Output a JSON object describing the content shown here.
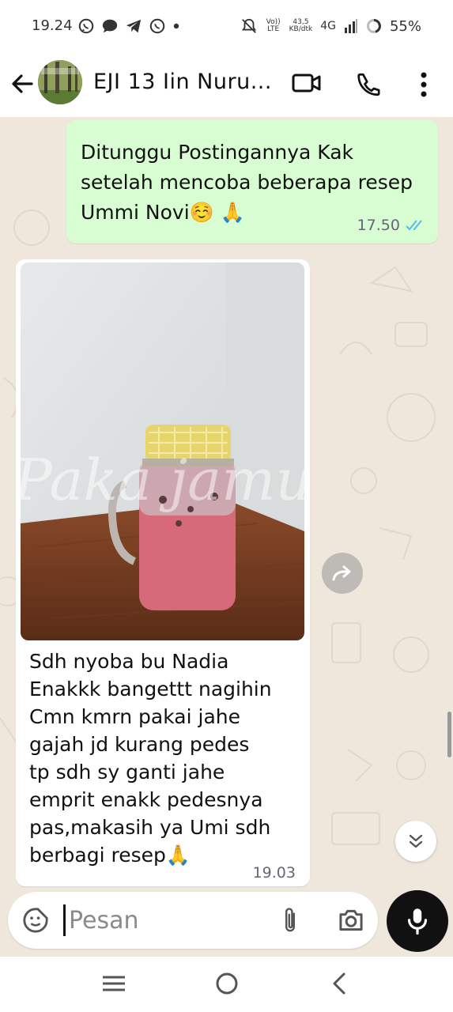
{
  "status_bar": {
    "time": "19.24",
    "net_speed_value": "43,5",
    "net_speed_unit": "KB/dtk",
    "volte": "Vo)) LTE",
    "network": "4G",
    "battery": "55%"
  },
  "header": {
    "title": "EJI 13 Iin Nuru..."
  },
  "messages": {
    "outgoing": {
      "text": "Ditunggu Postingannya Kak setelah mencoba beberapa resep Ummi Novi☺️ 🙏",
      "time": "17.50"
    },
    "incoming": {
      "text": "Sdh nyoba bu Nadia\nEnakkk bangettt nagihin\nCmn kmrn pakai jahe\ngajah jd kurang pedes\ntp sdh sy ganti jahe\nemprit enakk pedesnya\npas,makasih ya Umi sdh\nberbagi resep🙏",
      "time": "19.03",
      "photo_watermark": "Paka jamu"
    }
  },
  "input": {
    "placeholder": "Pesan"
  },
  "colors": {
    "chat_bg": "#efe7dc",
    "outgoing_bubble": "#d9fdd3",
    "incoming_bubble": "#ffffff",
    "read_ticks": "#53bdeb",
    "mic_button": "#111111"
  },
  "icons": [
    "whatsapp-icon",
    "chat-icon",
    "telegram-icon",
    "whatsapp-icon",
    "dot-icon",
    "mute-icon",
    "signal-icon",
    "battery-icon",
    "back-arrow-icon",
    "video-call-icon",
    "phone-icon",
    "more-vert-icon",
    "forward-icon",
    "chevrons-down-icon",
    "sticker-icon",
    "attach-icon",
    "camera-icon",
    "mic-icon",
    "nav-recents-icon",
    "nav-home-icon",
    "nav-back-icon"
  ]
}
